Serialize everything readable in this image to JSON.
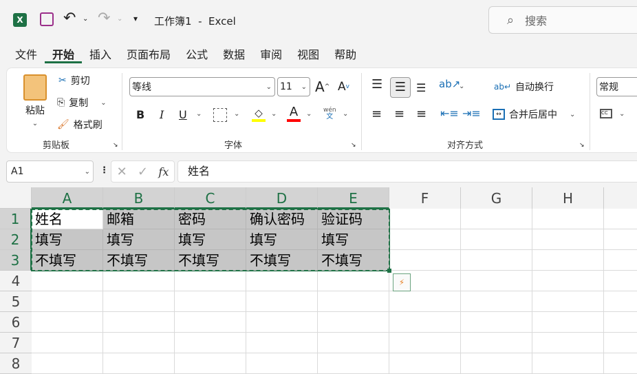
{
  "titlebar": {
    "title": "工作簿1  -  Excel",
    "search_placeholder": "搜索"
  },
  "menu": [
    "文件",
    "开始",
    "插入",
    "页面布局",
    "公式",
    "数据",
    "审阅",
    "视图",
    "帮助"
  ],
  "ribbon": {
    "clipboard": {
      "paste": "粘贴",
      "cut": "剪切",
      "copy": "复制",
      "format_painter": "格式刷",
      "group": "剪贴板"
    },
    "font": {
      "name": "等线",
      "size": "11",
      "bold": "B",
      "italic": "I",
      "underline": "U",
      "phonetic_top": "wén",
      "phonetic_bottom": "文",
      "grow": "A",
      "shrink": "A",
      "font_color": "A",
      "group": "字体",
      "fill_color": "#ffff00",
      "text_color": "#ff0000"
    },
    "alignment": {
      "wrap_text": "自动换行",
      "merge_center": "合并后居中",
      "group": "对齐方式"
    },
    "number": {
      "format": "常规"
    }
  },
  "formula_bar": {
    "name_box": "A1",
    "fx": "fx",
    "content": "姓名"
  },
  "sheet": {
    "columns": [
      "A",
      "B",
      "C",
      "D",
      "E",
      "F",
      "G",
      "H"
    ],
    "selected_columns": [
      "A",
      "B",
      "C",
      "D",
      "E"
    ],
    "rows": [
      "1",
      "2",
      "3",
      "4",
      "5",
      "6",
      "7",
      "8"
    ],
    "cells": [
      [
        "姓名",
        "邮箱",
        "密码",
        "确认密码",
        "验证码"
      ],
      [
        "填写",
        "填写",
        "填写",
        "填写",
        "填写"
      ],
      [
        "不填写",
        "不填写",
        "不填写",
        "不填写",
        "不填写"
      ]
    ],
    "selection": "A1:E3",
    "accent": "#1e7145"
  }
}
